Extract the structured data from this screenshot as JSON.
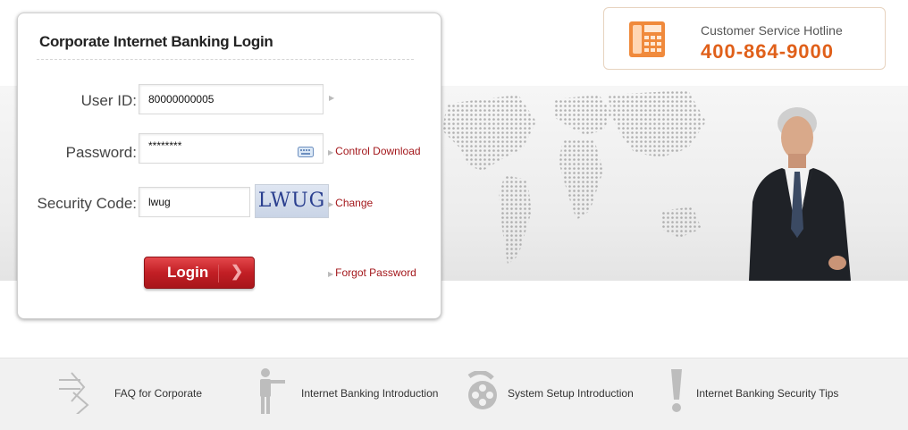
{
  "hotline": {
    "title": "Customer Service Hotline",
    "number": "400-864-9000",
    "icon": "phone-icon"
  },
  "login": {
    "title": "Corporate Internet Banking Login",
    "user_id_label": "User ID:",
    "user_id_value": "80000000005",
    "password_label": "Password:",
    "password_value": "********",
    "control_download": "Control Download",
    "security_code_label": "Security Code:",
    "security_code_value": "lwug",
    "captcha_text": "LWUG",
    "change_link": "Change",
    "login_button": "Login",
    "forgot_password": "Forgot Password"
  },
  "bottom_links": [
    {
      "label": "FAQ for Corporate",
      "icon": "double-arrow-icon"
    },
    {
      "label": "Internet Banking Introduction",
      "icon": "person-pointing-icon"
    },
    {
      "label": "System Setup Introduction",
      "icon": "film-reel-icon"
    },
    {
      "label": "Internet Banking Security Tips",
      "icon": "exclamation-icon"
    }
  ],
  "colors": {
    "accent_red": "#c21f25",
    "hotline_orange": "#e0601a",
    "link_red": "#a3171b"
  }
}
